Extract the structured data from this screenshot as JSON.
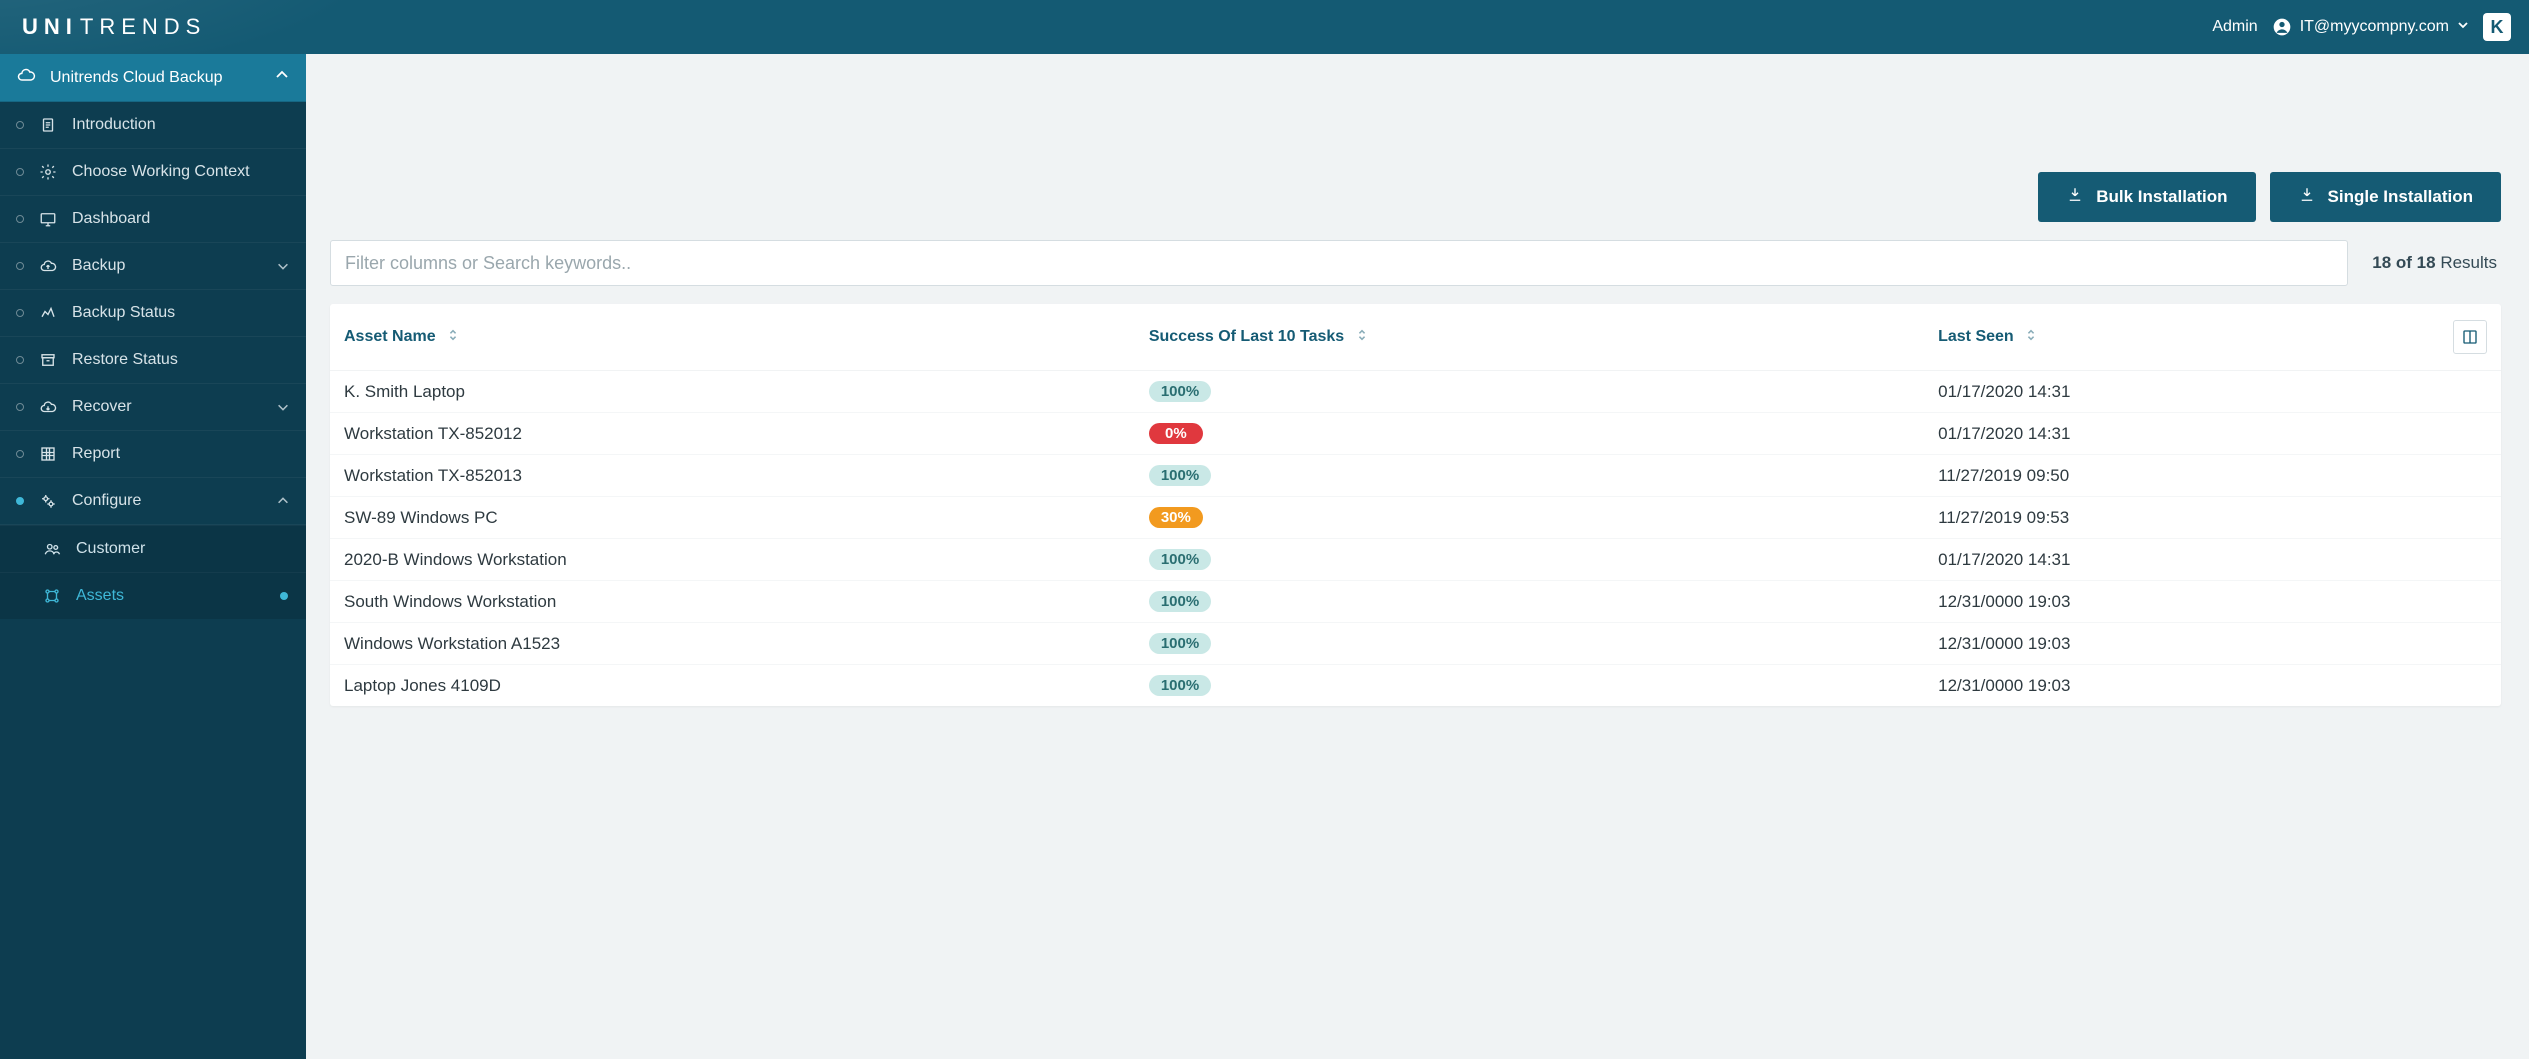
{
  "header": {
    "brand_uni": "UNI",
    "brand_trends": "TRENDS",
    "role_label": "Admin",
    "user_email": "IT@myycompny.com",
    "k_label": "K"
  },
  "sidebar": {
    "section_label": "Unitrends Cloud Backup",
    "items": [
      {
        "label": "Introduction",
        "icon": "doc"
      },
      {
        "label": "Choose Working Context",
        "icon": "gear"
      },
      {
        "label": "Dashboard",
        "icon": "monitor"
      },
      {
        "label": "Backup",
        "icon": "cloud-up",
        "expandable": true
      },
      {
        "label": "Backup Status",
        "icon": "status"
      },
      {
        "label": "Restore Status",
        "icon": "archive"
      },
      {
        "label": "Recover",
        "icon": "cloud-down",
        "expandable": true
      },
      {
        "label": "Report",
        "icon": "grid"
      },
      {
        "label": "Configure",
        "icon": "gears",
        "expandable": true,
        "active": true,
        "open": true
      }
    ],
    "configure_children": [
      {
        "label": "Customer",
        "icon": "users"
      },
      {
        "label": "Assets",
        "icon": "nodes",
        "active": true
      }
    ]
  },
  "toolbar": {
    "bulk_label": "Bulk Installation",
    "single_label": "Single Installation"
  },
  "search": {
    "placeholder": "Filter columns or Search keywords.."
  },
  "results": {
    "prefix_bold": "18 of 18",
    "suffix": "Results"
  },
  "table": {
    "columns": {
      "asset": "Asset Name",
      "success": "Success Of Last 10 Tasks",
      "last_seen": "Last Seen"
    },
    "rows": [
      {
        "asset": "K. Smith Laptop",
        "success": "100%",
        "status": "green",
        "last_seen": "01/17/2020 14:31"
      },
      {
        "asset": "Workstation TX-852012",
        "success": "0%",
        "status": "red",
        "last_seen": "01/17/2020 14:31"
      },
      {
        "asset": "Workstation TX-852013",
        "success": "100%",
        "status": "green",
        "last_seen": "11/27/2019 09:50"
      },
      {
        "asset": "SW-89 Windows PC",
        "success": "30%",
        "status": "orange",
        "last_seen": "11/27/2019 09:53"
      },
      {
        "asset": "2020-B Windows Workstation",
        "success": "100%",
        "status": "green",
        "last_seen": "01/17/2020 14:31"
      },
      {
        "asset": "South Windows Workstation",
        "success": "100%",
        "status": "green",
        "last_seen": "12/31/0000 19:03"
      },
      {
        "asset": "Windows Workstation A1523",
        "success": "100%",
        "status": "green",
        "last_seen": "12/31/0000 19:03"
      },
      {
        "asset": "Laptop Jones 4109D",
        "success": "100%",
        "status": "green",
        "last_seen": "12/31/0000 19:03"
      }
    ]
  }
}
